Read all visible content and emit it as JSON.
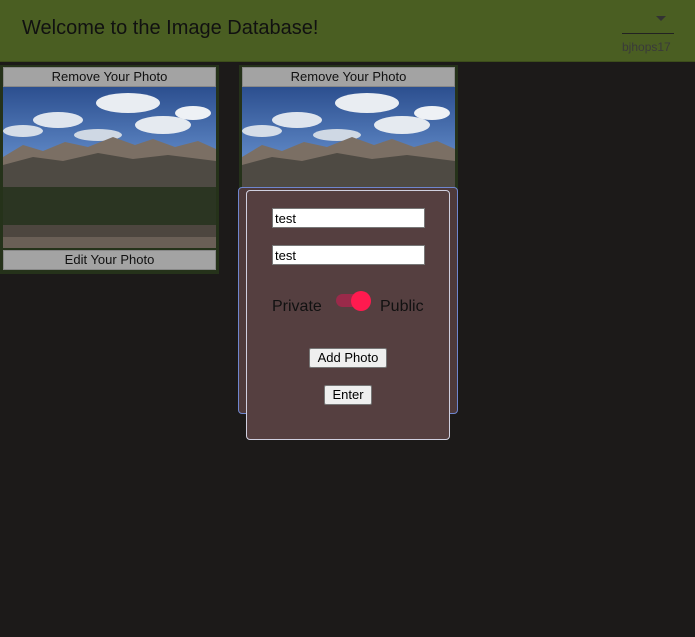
{
  "header": {
    "title": "Welcome to the Image Database!",
    "username": "bjhops17",
    "menu_icon": "chevron-down-icon",
    "background": "#4a5e22"
  },
  "cards": [
    {
      "remove_label": "Remove Your Photo",
      "edit_label": "Edit Your Photo"
    },
    {
      "remove_label": "Remove Your Photo"
    }
  ],
  "modal": {
    "title_value": "test",
    "description_value": "test",
    "toggle": {
      "left_label": "Private",
      "right_label": "Public",
      "state": "public"
    },
    "add_photo_label": "Add Photo",
    "enter_label": "Enter",
    "background": "#553f40",
    "accent": "#ff1a4f"
  }
}
